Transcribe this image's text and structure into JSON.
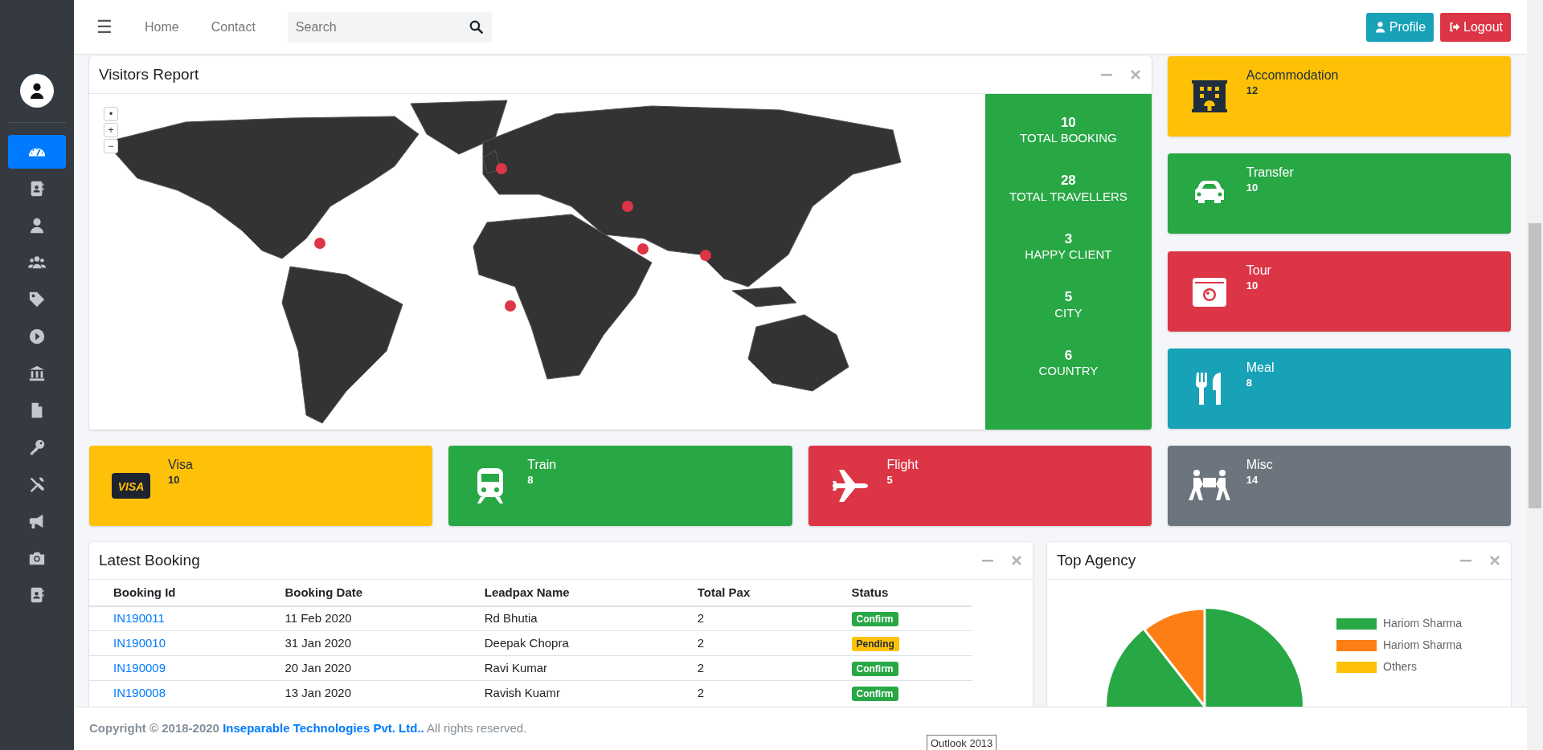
{
  "topbar": {
    "menu_glyph": "☰",
    "links": [
      "Home",
      "Contact"
    ],
    "search": {
      "placeholder": "Search"
    },
    "buttons": [
      {
        "label": "Profile",
        "kind": "profile"
      },
      {
        "label": "Logout",
        "kind": "logout"
      }
    ]
  },
  "sidebar": {
    "items": [
      {
        "selected": true
      },
      {
        "selected": false
      },
      {
        "selected": false
      },
      {
        "selected": false
      },
      {
        "selected": false
      },
      {
        "selected": false
      },
      {
        "selected": false
      },
      {
        "selected": false
      },
      {
        "selected": false
      },
      {
        "selected": false
      },
      {
        "selected": false
      },
      {
        "selected": false
      },
      {
        "selected": false
      }
    ]
  },
  "visitors_report": {
    "title": "Visitors Report",
    "zoom_controls": [
      "•",
      "+",
      "−"
    ],
    "stats": [
      {
        "value": "10",
        "label": "TOTAL BOOKING"
      },
      {
        "value": "28",
        "label": "TOTAL TRAVELLERS"
      },
      {
        "value": "3",
        "label": "HAPPY CLIENT"
      },
      {
        "value": "5",
        "label": "CITY"
      },
      {
        "value": "6",
        "label": "COUNTRY"
      }
    ]
  },
  "side_tiles": [
    {
      "title": "Accommodation",
      "value": "12",
      "color": "#ffc107"
    },
    {
      "title": "Transfer",
      "value": "10",
      "color": "#28a745"
    },
    {
      "title": "Tour",
      "value": "10",
      "color": "#dc3545"
    },
    {
      "title": "Meal",
      "value": "8",
      "color": "#17a2b8"
    }
  ],
  "service_tiles": [
    {
      "title": "Visa",
      "value": "10",
      "color": "#ffc107",
      "logo_text": "VISA"
    },
    {
      "title": "Train",
      "value": "8",
      "color": "#28a745"
    },
    {
      "title": "Flight",
      "value": "5",
      "color": "#dc3545"
    },
    {
      "title": "Misc",
      "value": "14",
      "color": "#6c757d"
    }
  ],
  "latest_booking": {
    "title": "Latest Booking",
    "columns": [
      "Booking Id",
      "Booking Date",
      "Leadpax Name",
      "Total Pax",
      "Status"
    ],
    "rows": [
      {
        "id": "IN190011",
        "date": "11 Feb 2020",
        "name": "Rd Bhutia",
        "pax": "2",
        "status": "Confirm",
        "kind": "confirm"
      },
      {
        "id": "IN190010",
        "date": "31 Jan 2020",
        "name": "Deepak Chopra",
        "pax": "2",
        "status": "Pending",
        "kind": "pending"
      },
      {
        "id": "IN190009",
        "date": "20 Jan 2020",
        "name": "Ravi Kumar",
        "pax": "2",
        "status": "Confirm",
        "kind": "confirm"
      },
      {
        "id": "IN190008",
        "date": "13 Jan 2020",
        "name": "Ravish Kuamr",
        "pax": "2",
        "status": "Confirm",
        "kind": "confirm"
      }
    ]
  },
  "top_agency": {
    "title": "Top Agency",
    "legend": [
      {
        "label": "Hariom Sharma",
        "color": "#28a745"
      },
      {
        "label": "Hariom Sharma",
        "color": "#fd7e14"
      },
      {
        "label": "Others",
        "color": "#ffc107"
      }
    ]
  },
  "footer": {
    "prefix": "Copyright © 2018-2020",
    "link": "Inseparable Technologies Pvt. Ltd..",
    "suffix": "All rights reserved."
  },
  "tooltip": "Outlook 2013"
}
